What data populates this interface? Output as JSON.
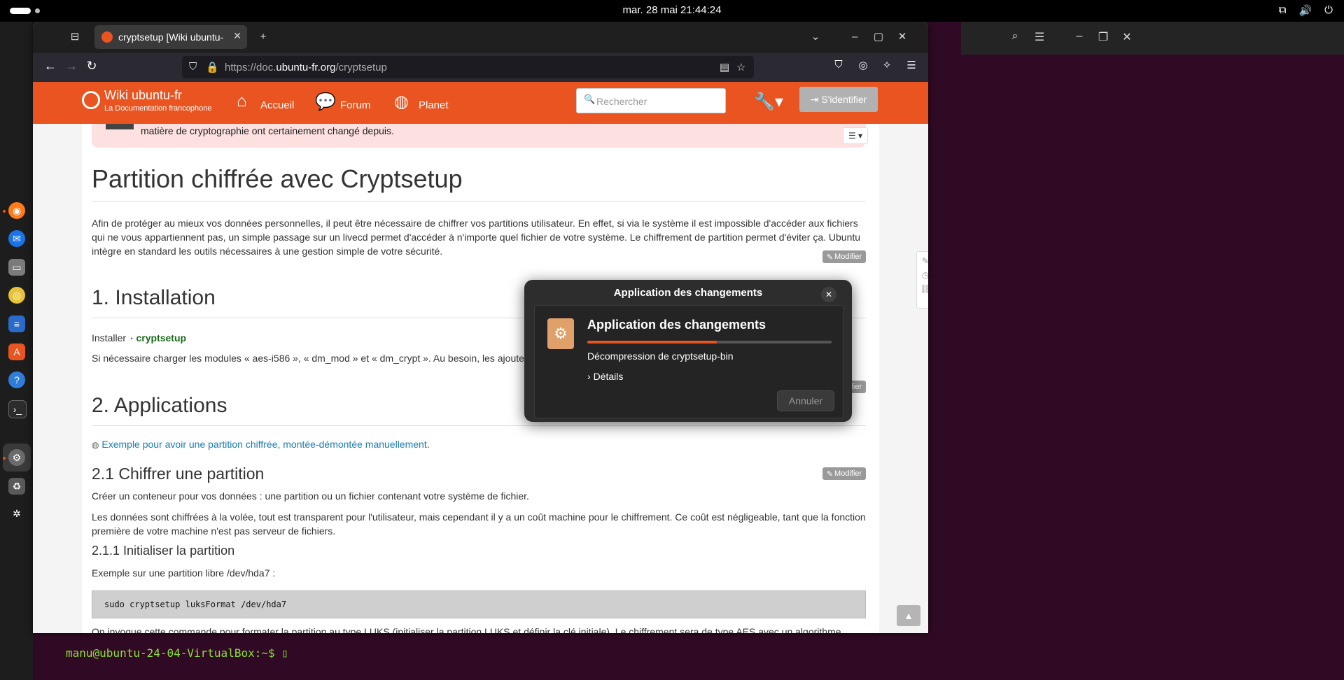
{
  "system": {
    "clock": "mar. 28 mai  21:44:24",
    "tray_icons": [
      "network-icon",
      "volume-icon",
      "power-icon"
    ]
  },
  "dock": {
    "apps": [
      "firefox",
      "thunderbird",
      "files",
      "rhythmbox",
      "writer",
      "app-center",
      "help",
      "terminal",
      "software-updater",
      "trash",
      "ubuntu"
    ]
  },
  "terminal": {
    "prompt": "manu@ubuntu-24-04-VirtualBox:~$"
  },
  "browser": {
    "tab_title": "cryptsetup [Wiki ubuntu-fr]",
    "url_prefix": "https://doc.",
    "url_domain": "ubuntu-fr.org",
    "url_path": "/cryptsetup"
  },
  "wiki": {
    "logo_title": "Wiki ubuntu-fr",
    "logo_subtitle": "La Documentation francophone",
    "nav": {
      "home": "Accueil",
      "forum": "Forum",
      "planet": "Planet"
    },
    "search_placeholder": "Rechercher",
    "login": "S'identifier",
    "notice_text": "matière de cryptographie ont certainement changé depuis.",
    "edit_label": "Modifier",
    "title": "Partition chiffrée avec Cryptsetup",
    "intro": "Afin de protéger au mieux vos données personnelles, il peut être nécessaire de chiffrer vos partitions utilisateur. En effet, si via le système il est impossible d'accéder aux fichiers qui ne vous appartiennent pas, un simple passage sur un livecd permet d'accéder à n'importe quel fichier de votre système. Le chiffrement de partition permet d'éviter ça. Ubuntu intègre en standard les outils nécessaires à une gestion simple de votre sécurité.",
    "s1_title": "1. Installation",
    "install_label": "Installer",
    "install_pkg": "cryptsetup",
    "modules_text": "Si nécessaire charger les modules « aes-i586 », « dm_mod » et « dm_crypt ». Au besoin, les ajouter",
    "s2_title": "2. Applications",
    "s2_link": "Exemple pour avoir une partition chiffrée, montée-démontée manuellement",
    "s21_title": "2.1 Chiffrer une partition",
    "s21_p1": "Créer un conteneur pour vos données : une partition ou un fichier contenant votre système de fichier.",
    "s21_p2": "Les données sont chiffrées à la volée, tout est transparent pour l'utilisateur, mais cependant il y a un coût machine pour le chiffrement. Ce coût est négligeable, tant que la fonction première de votre machine n'est pas serveur de fichiers.",
    "s211_title": "2.1.1 Initialiser la partition",
    "s211_p": "Exemple sur une partition libre /dev/hda7 :",
    "code": "sudo cryptsetup luksFormat  /dev/hda7",
    "last_line": "On invoque cette commande pour formater la partition au type LUKS (initialiser la partition LUKS et définir la clé initiale). Le chiffrement sera de type AES avec un algorithme"
  },
  "dialog": {
    "title": "Application des changements",
    "heading": "Application des changements",
    "status": "Décompression de cryptsetup-bin",
    "details": "Détails",
    "cancel": "Annuler",
    "progress": 0.53
  },
  "colors": {
    "ubuntu_orange": "#e95420",
    "terminal_bg": "#300a24"
  }
}
